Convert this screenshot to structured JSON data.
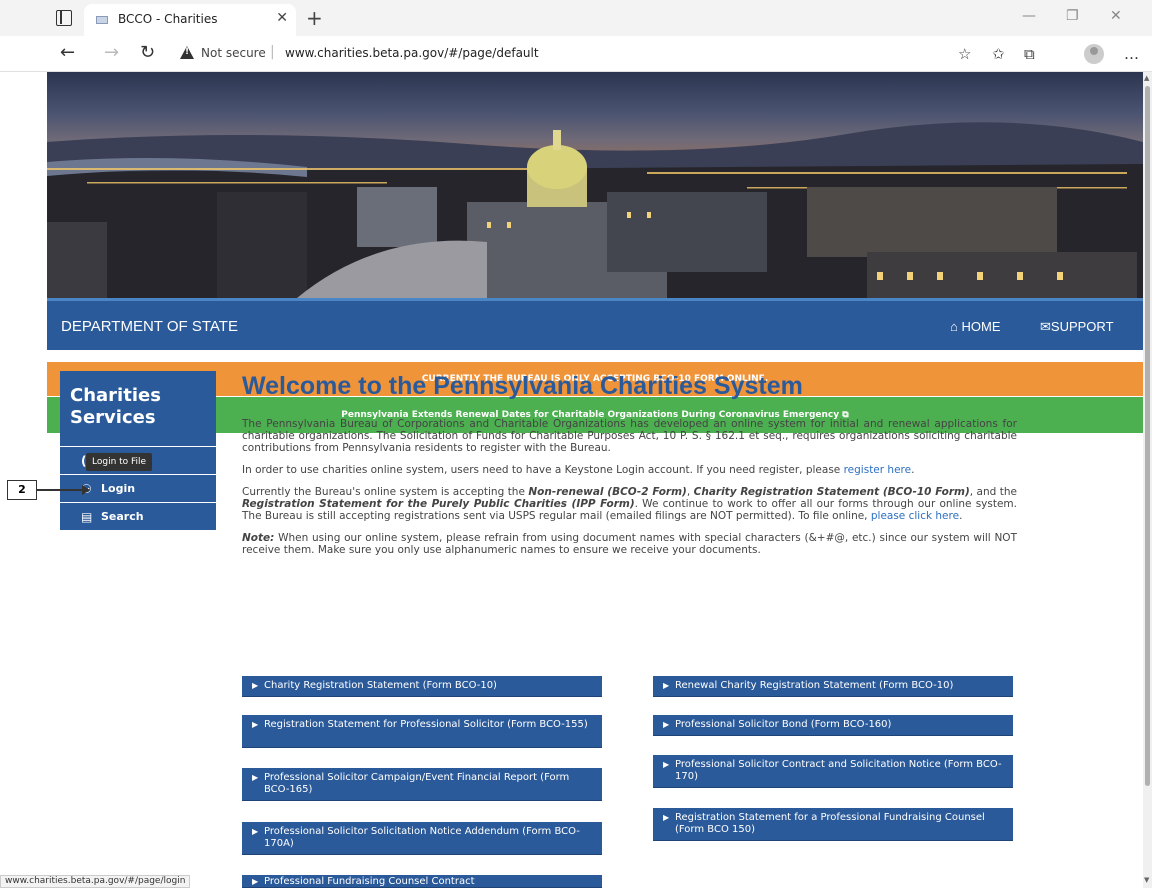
{
  "browser": {
    "tab_title": "BCCO - Charities",
    "not_secure": "Not secure",
    "url": "www.charities.beta.pa.gov/#/page/default",
    "status_url": "www.charities.beta.pa.gov/#/page/login"
  },
  "header": {
    "dept": "DEPARTMENT OF STATE",
    "home": "HOME",
    "support": "SUPPORT"
  },
  "banners": {
    "orange": "CURRENTLY THE BUREAU IS ONLY ACCEPTING BCO-10 FORM ONLINE.",
    "green": "Pennsylvania Extends Renewal Dates for Charitable Organizations During Coronavirus Emergency"
  },
  "sidebar": {
    "title_line1": "Charities",
    "title_line2": "Services",
    "item_hidden_initial": "(",
    "tooltip": "Login to File",
    "login": "Login",
    "search": "Search"
  },
  "annotation": "2",
  "main": {
    "title": "Welcome to the Pennsylvania Charities System",
    "p1": "The Pennsylvania Bureau of Corporations and Charitable Organizations has developed an online system for initial and renewal applications for charitable organizations. The Solicitation of Funds for Charitable Purposes Act, 10 P. S. § 162.1 et seq., requires organizations soliciting charitable contributions from Pennsylvania residents to register with the Bureau.",
    "p2_pre": "In order to use charities online system, users need to have a Keystone Login account. If you need register, please ",
    "p2_link": "register here",
    "p2_post": ".",
    "p3_a": "Currently the Bureau's online system is accepting the ",
    "p3_b": "Non-renewal (BCO-2 Form)",
    "p3_c": ", ",
    "p3_d": "Charity Registration Statement (BCO-10 Form)",
    "p3_e": ", and the ",
    "p3_f": "Registration Statement for the Purely Public Charities (IPP Form)",
    "p3_g": ". We continue to work to offer all our forms through our online system. The Bureau is still accepting registrations sent via USPS regular mail (emailed filings are NOT permitted). To file online, ",
    "p3_link": "please click here",
    "p3_h": ".",
    "p4_note": "Note:",
    "p4": " When using our online system, please refrain from using document names with special characters (&+#@, etc.) since our system will NOT receive them.  Make sure you only use alphanumeric names to ensure we receive your documents."
  },
  "forms": {
    "left": [
      "Charity Registration Statement (Form BCO-10)",
      "Registration Statement for Professional Solicitor (Form BCO-155)",
      "Professional Solicitor Campaign/Event Financial Report (Form BCO-165)",
      "Professional Solicitor Solicitation Notice Addendum (Form BCO-170A)",
      "Professional Fundraising Counsel Contract"
    ],
    "right": [
      "Renewal Charity Registration Statement (Form BCO-10)",
      "Professional Solicitor Bond (Form BCO-160)",
      "Professional Solicitor Contract and Solicitation Notice (Form BCO-170)",
      "Registration Statement for a Professional Fundraising Counsel (Form BCO 150)"
    ]
  },
  "colors": {
    "primary_blue": "#2b5a9a",
    "orange": "#f0943a",
    "green": "#4caf50",
    "link": "#2b6fc2"
  }
}
